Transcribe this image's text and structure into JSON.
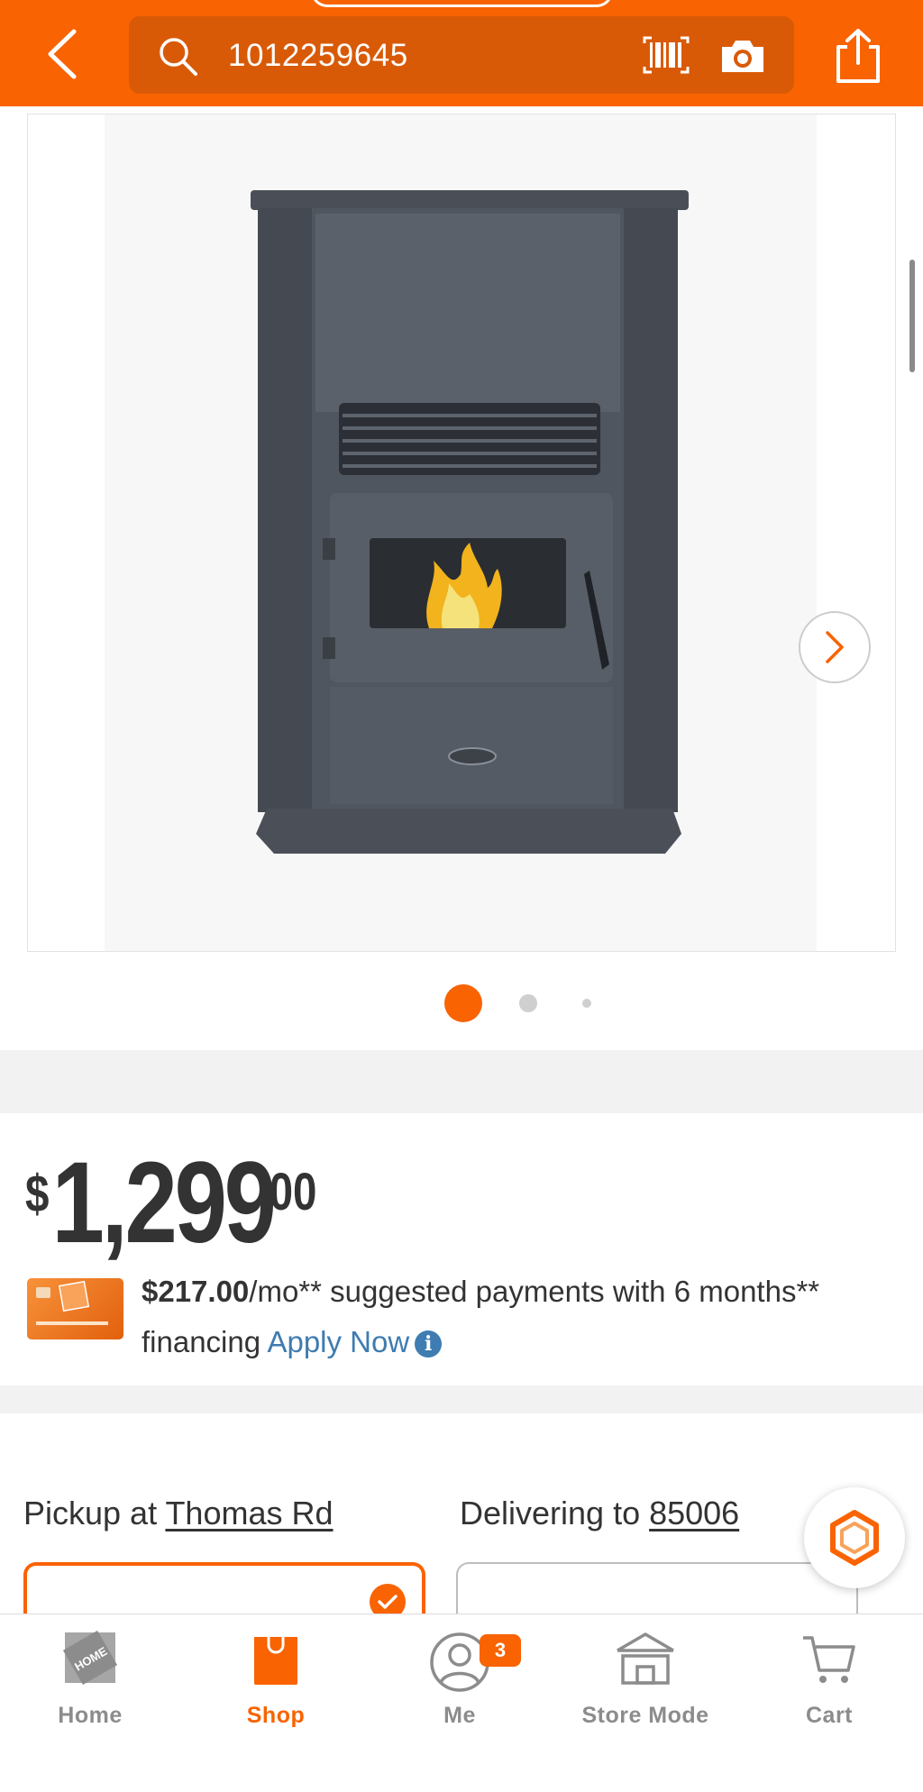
{
  "colors": {
    "brand_orange": "#f96302",
    "search_bg": "#d95a06",
    "link_blue": "#3e7cb1",
    "text_dark": "#333333",
    "nav_gray": "#8c8c8c"
  },
  "header": {
    "back_icon": "chevron-left-icon",
    "search": {
      "icon": "search-icon",
      "value": "1012259645"
    },
    "barcode_icon": "barcode-scan-icon",
    "camera_icon": "camera-icon",
    "share_icon": "share-icon"
  },
  "gallery": {
    "image": "pellet-stove-product-image",
    "next_icon": "chevron-right-icon",
    "image_count": 3,
    "active_index": 0
  },
  "price": {
    "symbol": "$",
    "dollars": "1,299",
    "cents": "00"
  },
  "financing": {
    "card_icon": "home-depot-credit-card-icon",
    "amount": "$217.00",
    "text": "/mo** suggested payments with 6 months** financing ",
    "link": "Apply Now",
    "info_icon": "info-icon"
  },
  "fulfillment": {
    "pickup_prefix": "Pickup at ",
    "pickup_store": "Thomas Rd",
    "delivery_prefix": "Delivering to ",
    "delivery_zip": "85006",
    "pickup_selected": true
  },
  "chat_fab_icon": "chat-assistant-icon",
  "bottom_nav": {
    "items": [
      {
        "label": "Home",
        "icon": "home-depot-logo-icon"
      },
      {
        "label": "Shop",
        "icon": "shop-bag-icon",
        "active": true
      },
      {
        "label": "Me",
        "icon": "user-icon",
        "badge": "3"
      },
      {
        "label": "Store Mode",
        "icon": "store-icon"
      },
      {
        "label": "Cart",
        "icon": "cart-icon"
      }
    ]
  }
}
